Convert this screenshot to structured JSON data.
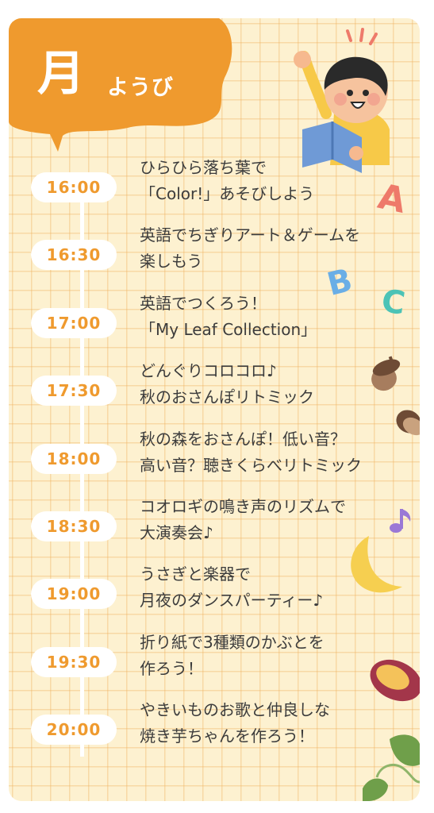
{
  "header": {
    "day_kanji": "月",
    "day_suffix": "ようび"
  },
  "schedule": [
    {
      "time": "16:00",
      "line1": "ひらひら落ち葉で",
      "line2": "「Color!」あそびしよう"
    },
    {
      "time": "16:30",
      "line1": "英語でちぎりアート＆ゲームを",
      "line2": "楽しもう"
    },
    {
      "time": "17:00",
      "line1": "英語でつくろう！",
      "line2": "「My Leaf Collection」"
    },
    {
      "time": "17:30",
      "line1": "どんぐりコロコロ♪",
      "line2": "秋のおさんぽリトミック"
    },
    {
      "time": "18:00",
      "line1": "秋の森をおさんぽ！低い音？",
      "line2": "高い音？聴きくらべリトミック"
    },
    {
      "time": "18:30",
      "line1": "コオロギの鳴き声のリズムで",
      "line2": "大演奏会♪"
    },
    {
      "time": "19:00",
      "line1": "うさぎと楽器で",
      "line2": "月夜のダンスパーティー♪"
    },
    {
      "time": "19:30",
      "line1": "折り紙で3種類のかぶとを",
      "line2": "作ろう！"
    },
    {
      "time": "20:00",
      "line1": "やきいものお歌と仲良しな",
      "line2": "焼き芋ちゃんを作ろう！"
    }
  ],
  "decorations": {
    "letter_a": "A",
    "letter_b": "B",
    "letter_c": "C",
    "icons": [
      "boy-reading-icon",
      "acorn-icon",
      "music-note-icon",
      "crescent-moon-icon",
      "sweet-potato-icon",
      "leaf-vine-icon"
    ]
  },
  "colors": {
    "accent_orange": "#ef9a2e",
    "background": "#fdf1d0",
    "text": "#3c3c3c",
    "letter_a": "#ee7a6a",
    "letter_b": "#6aaee6",
    "letter_c": "#4cc3b6"
  }
}
